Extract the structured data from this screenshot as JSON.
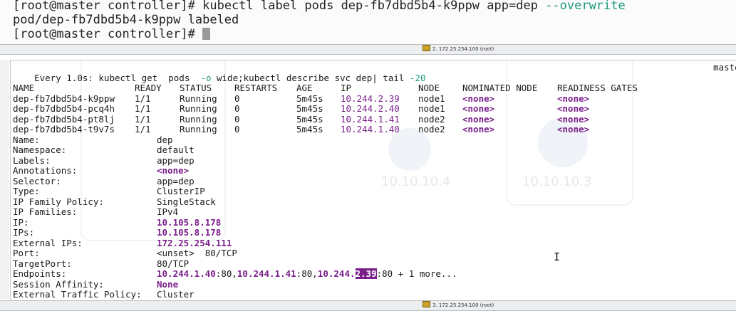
{
  "terminal_top": {
    "line1_prompt": "[root@master controller]# ",
    "line1_cmd": "kubectl label pods dep-fb7dbd5b4-k9ppw app=dep ",
    "line1_flag": "--overwrite",
    "line2": "pod/dep-fb7dbd5b4-k9ppw labeled",
    "line3_prompt": "[root@master controller]# "
  },
  "tab_bars": [
    {
      "label": "2. 172.25.254.100 (root)"
    },
    {
      "label": "3. 172.25.254.100 (root)"
    }
  ],
  "watch": {
    "every": "Every 1.0s: ",
    "cmd_a": "kubectl get  pods  ",
    "cmd_flag": "-o",
    "cmd_b": " wide;kubectl describe svc dep| tail ",
    "cmd_num": "-20",
    "host": "maste"
  },
  "pods_table": {
    "headers": [
      "NAME",
      "READY",
      "STATUS",
      "RESTARTS",
      "AGE",
      "IP",
      "NODE",
      "NOMINATED NODE",
      "READINESS GATES"
    ],
    "rows": [
      [
        "dep-fb7dbd5b4-k9ppw",
        "1/1",
        "Running",
        "0",
        "5m45s",
        "10.244.2.39",
        "node1",
        "<none>",
        "<none>"
      ],
      [
        "dep-fb7dbd5b4-pcq4h",
        "1/1",
        "Running",
        "0",
        "5m45s",
        "10.244.2.40",
        "node1",
        "<none>",
        "<none>"
      ],
      [
        "dep-fb7dbd5b4-pt8lj",
        "1/1",
        "Running",
        "0",
        "5m45s",
        "10.244.1.41",
        "node2",
        "<none>",
        "<none>"
      ],
      [
        "dep-fb7dbd5b4-t9v7s",
        "1/1",
        "Running",
        "0",
        "5m45s",
        "10.244.1.40",
        "node2",
        "<none>",
        "<none>"
      ]
    ]
  },
  "svc": {
    "name": {
      "key": "Name:",
      "val": "dep"
    },
    "namespace": {
      "key": "Namespace:",
      "val": "default"
    },
    "labels": {
      "key": "Labels:",
      "val": "app=dep"
    },
    "annotations": {
      "key": "Annotations:",
      "val": "<none>"
    },
    "selector": {
      "key": "Selector:",
      "val": "app=dep"
    },
    "type": {
      "key": "Type:",
      "val": "ClusterIP"
    },
    "ip_family_policy": {
      "key": "IP Family Policy:",
      "val": "SingleStack"
    },
    "ip_families": {
      "key": "IP Families:",
      "val": "IPv4"
    },
    "ip": {
      "key": "IP:",
      "val": "10.105.8.178"
    },
    "ips": {
      "key": "IPs:",
      "val": "10.105.8.178"
    },
    "external_ips": {
      "key": "External IPs:",
      "val": "172.25.254.111"
    },
    "port": {
      "key": "Port:",
      "val_a": "<unset>",
      "val_b": "  80/TCP"
    },
    "target_port": {
      "key": "TargetPort:",
      "val": "80/TCP"
    },
    "endpoints": {
      "key": "Endpoints:",
      "e1": "10.244.1.40",
      "p1": ":80,",
      "e2": "10.244.1.41",
      "p2": ":80,",
      "e3a": "10.244.",
      "e3b": "2.39",
      "p3": ":80 + 1 more..."
    },
    "session_affinity": {
      "key": "Session Affinity:",
      "val": "None"
    },
    "external_traffic_policy": {
      "key": "External Traffic Policy:",
      "val": "Cluster"
    }
  },
  "colors": {
    "purple": "#7a1f8a",
    "flag_green": "#1a9a7a",
    "highlight_bg": "#7a1f8a"
  },
  "icons": [
    "i-beam-cursor-icon",
    "terminal-tab-icon"
  ]
}
